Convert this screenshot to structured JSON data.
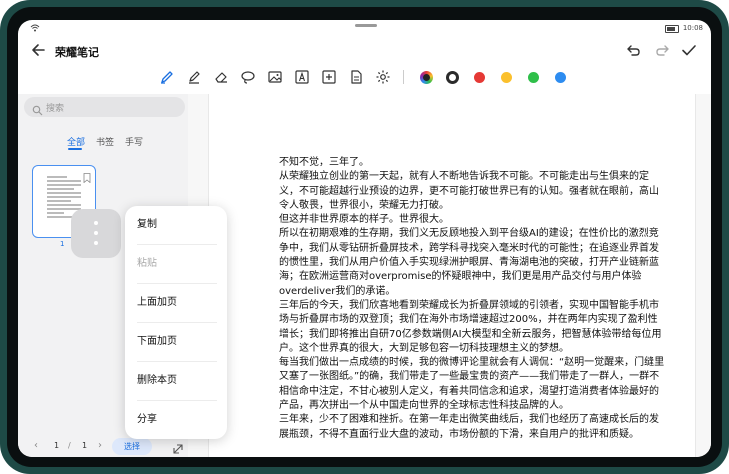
{
  "status_bar": {
    "time": "10:08",
    "wifi_icon": "wifi-icon",
    "battery_icon": "battery-icon"
  },
  "header": {
    "title": "荣耀笔记"
  },
  "toolbar": {
    "tools": [
      "pen-icon",
      "highlighter-icon",
      "eraser-icon",
      "lasso-icon",
      "image-icon",
      "text-box-icon",
      "insert-icon",
      "document-icon",
      "settings-icon"
    ],
    "colors": [
      "#2b2b2b",
      "#e53935",
      "#fbc02d",
      "#2fbf4a",
      "#2d8cf0"
    ],
    "active_color": "#2b2b2b"
  },
  "sidebar": {
    "search_placeholder": "搜索",
    "filters": [
      "全部",
      "书签",
      "手写"
    ],
    "active_filter": "全部",
    "page_thumb_number": "1",
    "pager": {
      "current": "1",
      "separator": "/",
      "total": "1",
      "select_label": "选择"
    }
  },
  "context_menu": {
    "items": [
      {
        "label": "复制",
        "enabled": true
      },
      {
        "label": "粘贴",
        "enabled": false
      },
      {
        "label": "上面加页",
        "enabled": true
      },
      {
        "label": "下面加页",
        "enabled": true
      },
      {
        "label": "删除本页",
        "enabled": true
      },
      {
        "label": "分享",
        "enabled": true
      }
    ]
  },
  "document": {
    "lines": [
      "不知不觉，三年了。",
      "从荣耀独立创业的第一天起，就有人不断地告诉我不可能。不可能走出与生俱来的定义，不可能超越行业预设的边界，更不可能打破世界已有的认知。强者就在眼前，高山令人敬畏，世界很小，荣耀无力打破。",
      "但这并非世界原本的样子。世界很大。",
      "所以在初期艰难的生存期，我们义无反顾地投入到平台级AI的建设；在性价比的激烈竞争中，我们从零钻研折叠屏技术，跨学科寻找突入毫米时代的可能性；在追逐业界首发的惯性里，我们从用户价值入手实现绿洲护眼屏、青海湖电池的突破，打开产业链新蓝海；在欧洲运营商对overpromise的怀疑眼神中，我们更是用产品交付与用户体验overdeliver我们的承诺。",
      "三年后的今天，我们欣喜地看到荣耀成长为折叠屏领域的引领者，实现中国智能手机市场与折叠屏市场的双登顶；我们在海外市场增速超过200%，并在两年内实现了盈利性增长；我们即将推出自研70亿参数端侧AI大模型和全新云服务，把智慧体验带给每位用户。这个世界真的很大，大到足够包容一切科技理想主义的梦想。",
      "每当我们做出一点成绩的时候，我的微博评论里就会有人调侃：“赵明一觉醒来，门缝里又塞了一张图纸。”的确，我们带走了一些最宝贵的资产——我们带走了一群人，一群不相信命中注定，不甘心被别人定义，有着共同信念和追求，渴望打造消费者体验最好的产品，再次拼出一个从中国走向世界的全球标志性科技品牌的人。",
      "三年来，少不了困难和挫折。在第一年走出微笑曲线后，我们也经历了高速成长后的发展瓶颈，不得不直面行业大盘的波动，市场份额的下滑，来自用户的批评和质疑。"
    ]
  }
}
